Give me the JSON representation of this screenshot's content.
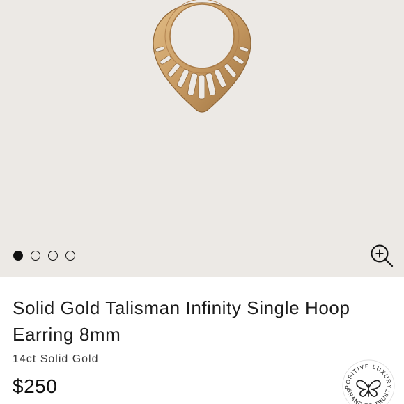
{
  "gallery": {
    "image_alt": "Solid Gold Talisman Infinity Single Hoop Earring 8mm",
    "slide_count": 4,
    "active_slide": 1,
    "zoom_icon": "zoom-in-icon"
  },
  "product": {
    "title": "Solid Gold Talisman Infinity Single Hoop Earring 8mm",
    "material": "14ct Solid Gold",
    "price": "$250"
  },
  "badge": {
    "top_text": "POSITIVE LUXURY",
    "bottom_text": "BRAND TO TRUST",
    "icon": "butterfly-icon"
  },
  "colors": {
    "gallery_bg": "#ece9e5",
    "gold": "#c79a62",
    "text": "#1a1a1a"
  }
}
